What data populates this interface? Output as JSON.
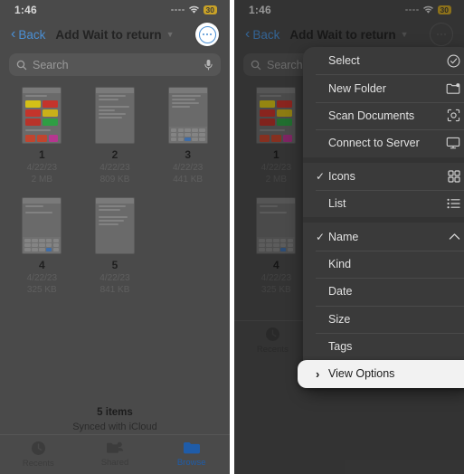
{
  "status": {
    "time": "1:46",
    "battery_level": "30",
    "battery_color": "#c9a227",
    "signal_icon": "signal-dots-icon",
    "wifi_icon": "wifi-icon"
  },
  "nav": {
    "back_label": "Back",
    "back_icon": "chevron-left-icon",
    "title": "Add Wait to return",
    "title_chevron_icon": "chevron-down-icon",
    "more_button_icon": "ellipsis-circle-icon",
    "accent": "#4a8fd4"
  },
  "search": {
    "placeholder": "Search",
    "search_icon": "magnifier-icon",
    "mic_icon": "microphone-icon"
  },
  "files": [
    {
      "name": "1",
      "date": "4/22/23",
      "size": "2 MB",
      "thumb": "colorful-grid"
    },
    {
      "name": "2",
      "date": "4/22/23",
      "size": "809 KB",
      "thumb": "list-doc"
    },
    {
      "name": "3",
      "date": "4/22/23",
      "size": "441 KB",
      "thumb": "keyboard-doc"
    },
    {
      "name": "4",
      "date": "4/22/23",
      "size": "325 KB",
      "thumb": "keyboard-doc"
    },
    {
      "name": "5",
      "date": "4/22/23",
      "size": "841 KB",
      "thumb": "list-doc"
    }
  ],
  "tiles_colors": [
    "#d4c017",
    "#c4342b",
    "#c4342b",
    "#c9b01a",
    "#b8332a",
    "#2f9e44",
    "#c1452f",
    "#b5368f"
  ],
  "footer": {
    "count": "5 items",
    "sync": "Synced with iCloud"
  },
  "tabs": [
    {
      "label": "Recents",
      "icon": "clock-icon",
      "active": false
    },
    {
      "label": "Shared",
      "icon": "shared-folder-icon",
      "active": false
    },
    {
      "label": "Browse",
      "icon": "folder-icon",
      "active": true
    }
  ],
  "menu": {
    "groups": [
      {
        "items": [
          {
            "label": "Select",
            "icon": "checkmark-circle-icon",
            "checked": false
          },
          {
            "label": "New Folder",
            "icon": "folder-plus-icon",
            "checked": false
          },
          {
            "label": "Scan Documents",
            "icon": "document-scanner-icon",
            "checked": false
          },
          {
            "label": "Connect to Server",
            "icon": "display-icon",
            "checked": false
          }
        ]
      },
      {
        "items": [
          {
            "label": "Icons",
            "icon": "grid-icon",
            "checked": true
          },
          {
            "label": "List",
            "icon": "list-icon",
            "checked": false
          }
        ]
      },
      {
        "items": [
          {
            "label": "Name",
            "icon": "chevron-up-icon",
            "checked": true
          },
          {
            "label": "Kind",
            "icon": "",
            "checked": false
          },
          {
            "label": "Date",
            "icon": "",
            "checked": false
          },
          {
            "label": "Size",
            "icon": "",
            "checked": false
          },
          {
            "label": "Tags",
            "icon": "",
            "checked": false
          }
        ]
      }
    ],
    "highlighted_item": {
      "label": "View Options",
      "leading_icon": "chevron-right-icon",
      "highlight_bg": "#f2f2f2"
    }
  }
}
